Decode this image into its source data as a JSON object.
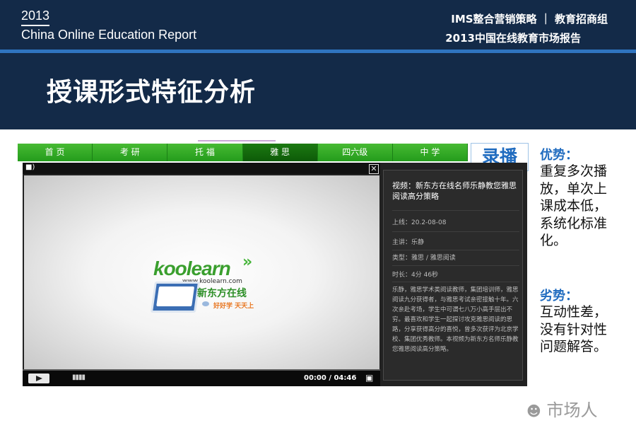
{
  "header": {
    "year": "2013",
    "report_en": "China Online Education Report",
    "org": "IMS整合营销策略 ｜ 教育招商组",
    "report_cn": "2013中国在线教育市场报告"
  },
  "page": {
    "title": "授课形式特征分析"
  },
  "player": {
    "nav": [
      "首 页",
      "考 研",
      "托 福",
      "雅 思",
      "四六级",
      "中 学"
    ],
    "active_nav": "雅 思",
    "badge": "录播",
    "logo": {
      "wordmark": "koolearn",
      "url": "www.koolearn.com",
      "cn": "新东方在线",
      "slogan": "好好学 天天上"
    },
    "time": "00:00 / 04:46",
    "info": {
      "title": "视频：新东方在线名师乐静教您雅思阅读高分策略",
      "date": "上线：20.2-08-08",
      "speaker": "主讲：乐静",
      "category": "类型：雅思 / 雅思阅读",
      "duration": "时长：4分 46秒",
      "desc": "乐静，雅思学术类阅读教师，集团培训师，雅思阅读九分获得者，与雅思考试亲密接触十年。六次亲赴考场，学生中可谓七八万小高手层出不穷。最喜欢和学生一起探讨攻克雅思阅读的思路，分享获得高分的喜悦，曾多次获评为北京学校、集团优秀教师。本视频为新东方名师乐静教您雅思阅读高分策略。"
    }
  },
  "advantages": {
    "head": "优势：",
    "body": "重复多次播放，单次上课成本低，系统化标准化。"
  },
  "disadvantages": {
    "head": "劣势：",
    "body": "互动性差，没有针对性问题解答。"
  },
  "watermark": "市场人",
  "colors": {
    "navy": "#132a48",
    "blue": "#1f6bbf",
    "green": "#249c1c"
  }
}
